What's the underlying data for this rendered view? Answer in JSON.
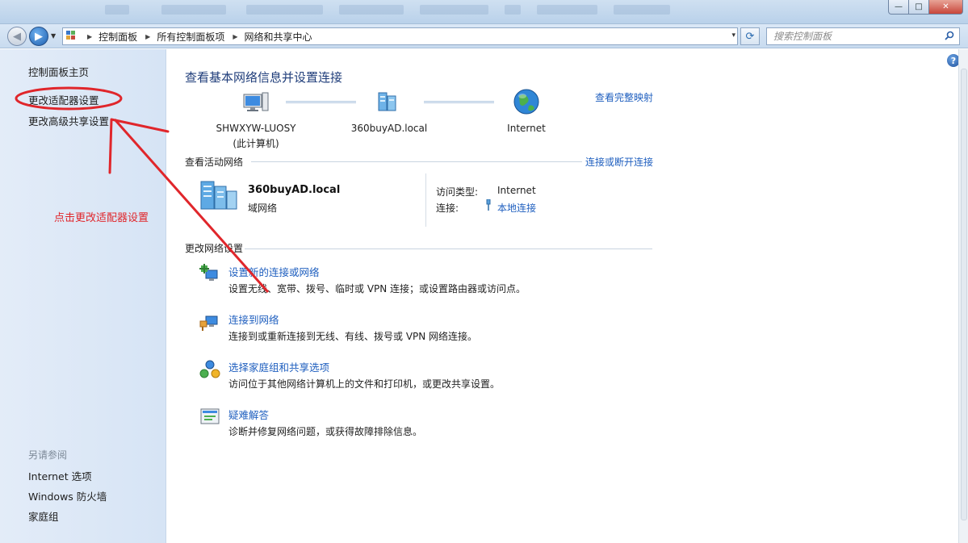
{
  "window": {
    "controls": {
      "minimize": "—",
      "maximize": "□",
      "close": "✕"
    }
  },
  "address": {
    "breadcrumbs": [
      "控制面板",
      "所有控制面板项",
      "网络和共享中心"
    ],
    "dropdown_icon": "▾",
    "refresh_icon": "⟳"
  },
  "search": {
    "placeholder": "搜索控制面板"
  },
  "sidebar": {
    "items": [
      {
        "label": "控制面板主页"
      },
      {
        "label": "更改适配器设置"
      },
      {
        "label": "更改高级共享设置"
      }
    ],
    "see_also_header": "另请参阅",
    "see_also": [
      {
        "label": "Internet 选项"
      },
      {
        "label": "Windows 防火墙"
      },
      {
        "label": "家庭组"
      }
    ]
  },
  "main": {
    "title": "查看基本网络信息并设置连接",
    "see_full_map": "查看完整映射",
    "map": {
      "computer": {
        "name": "SHWXYW-LUOSY",
        "subtitle": "(此计算机)"
      },
      "domain": {
        "name": "360buyAD.local"
      },
      "internet": {
        "name": "Internet"
      }
    },
    "active_networks": {
      "header": "查看活动网络",
      "action_link": "连接或断开连接",
      "network_name": "360buyAD.local",
      "network_type": "域网络",
      "access_type_label": "访问类型:",
      "access_type_value": "Internet",
      "connection_label": "连接:",
      "connection_value": "本地连接"
    },
    "change_settings": {
      "header": "更改网络设置",
      "tasks": [
        {
          "title": "设置新的连接或网络",
          "desc": "设置无线、宽带、拨号、临时或 VPN 连接；或设置路由器或访问点。",
          "icon": "new-connection-icon"
        },
        {
          "title": "连接到网络",
          "desc": "连接到或重新连接到无线、有线、拨号或 VPN 网络连接。",
          "icon": "connect-network-icon"
        },
        {
          "title": "选择家庭组和共享选项",
          "desc": "访问位于其他网络计算机上的文件和打印机，或更改共享设置。",
          "icon": "homegroup-icon"
        },
        {
          "title": "疑难解答",
          "desc": "诊断并修复网络问题，或获得故障排除信息。",
          "icon": "troubleshoot-icon"
        }
      ]
    }
  },
  "annotation": {
    "text": "点击更改适配器设置",
    "color": "#e0262b"
  },
  "colors": {
    "link": "#1f5fbf",
    "title": "#1f3d7a",
    "sidebar_bg": "#dbe7f6"
  }
}
